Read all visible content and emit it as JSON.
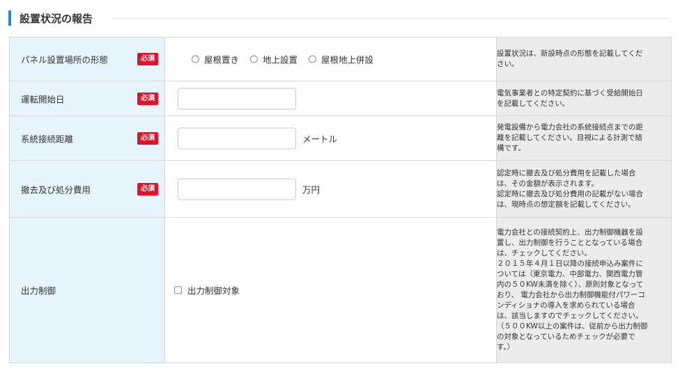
{
  "section": {
    "title": "設置状況の報告"
  },
  "required_label": "必須",
  "rows": {
    "panel": {
      "label": "パネル設置場所の形態",
      "options": [
        "屋根置き",
        "地上設置",
        "屋根地上併設"
      ],
      "note": [
        "設置状況は、新設時点の形態を記載してくだ",
        "さい。"
      ]
    },
    "start_date": {
      "label": "運転開始日",
      "value": "",
      "note": [
        "電気事業者との特定契約に基づく受給開始日",
        "を記載してください。"
      ]
    },
    "distance": {
      "label": "系統接続距離",
      "value": "",
      "unit": "メートル",
      "note": [
        "発電設備から電力会社の系統接続点までの距",
        "離を記載してください。目視による計測で結",
        "構です。"
      ]
    },
    "removal_cost": {
      "label": "撤去及び処分費用",
      "value": "",
      "unit": "万円",
      "note": [
        "認定時に撤去及び処分費用を記載した場合",
        "は、その金額が表示されます。",
        "認定時に撤去及び処分費用の記載がない場合",
        "は、現時点の想定額を記載してください。"
      ]
    },
    "output_control": {
      "label": "出力制御",
      "checkbox_label": "出力制御対象",
      "note": [
        "電力会社との接続契約上、出力制御機器を設",
        "置し、出力制御を行うこととなっている場合",
        "は、チェックしてください。",
        "２０１５年４月１日以降の接続申込み案件に",
        "ついては（東京電力、中部電力、関西電力管",
        "内の５０KW未満を除く）、原則対象となって",
        "おり、 電力会社から出力制御機能付パワーコ",
        "ンディショナの導入を求められている場合",
        "は、該当しますのでチェックしてください。",
        "（５００KW以上の案件は、従前から出力制御",
        "の対象となっているためチェックが必要で",
        "す。）"
      ]
    }
  }
}
